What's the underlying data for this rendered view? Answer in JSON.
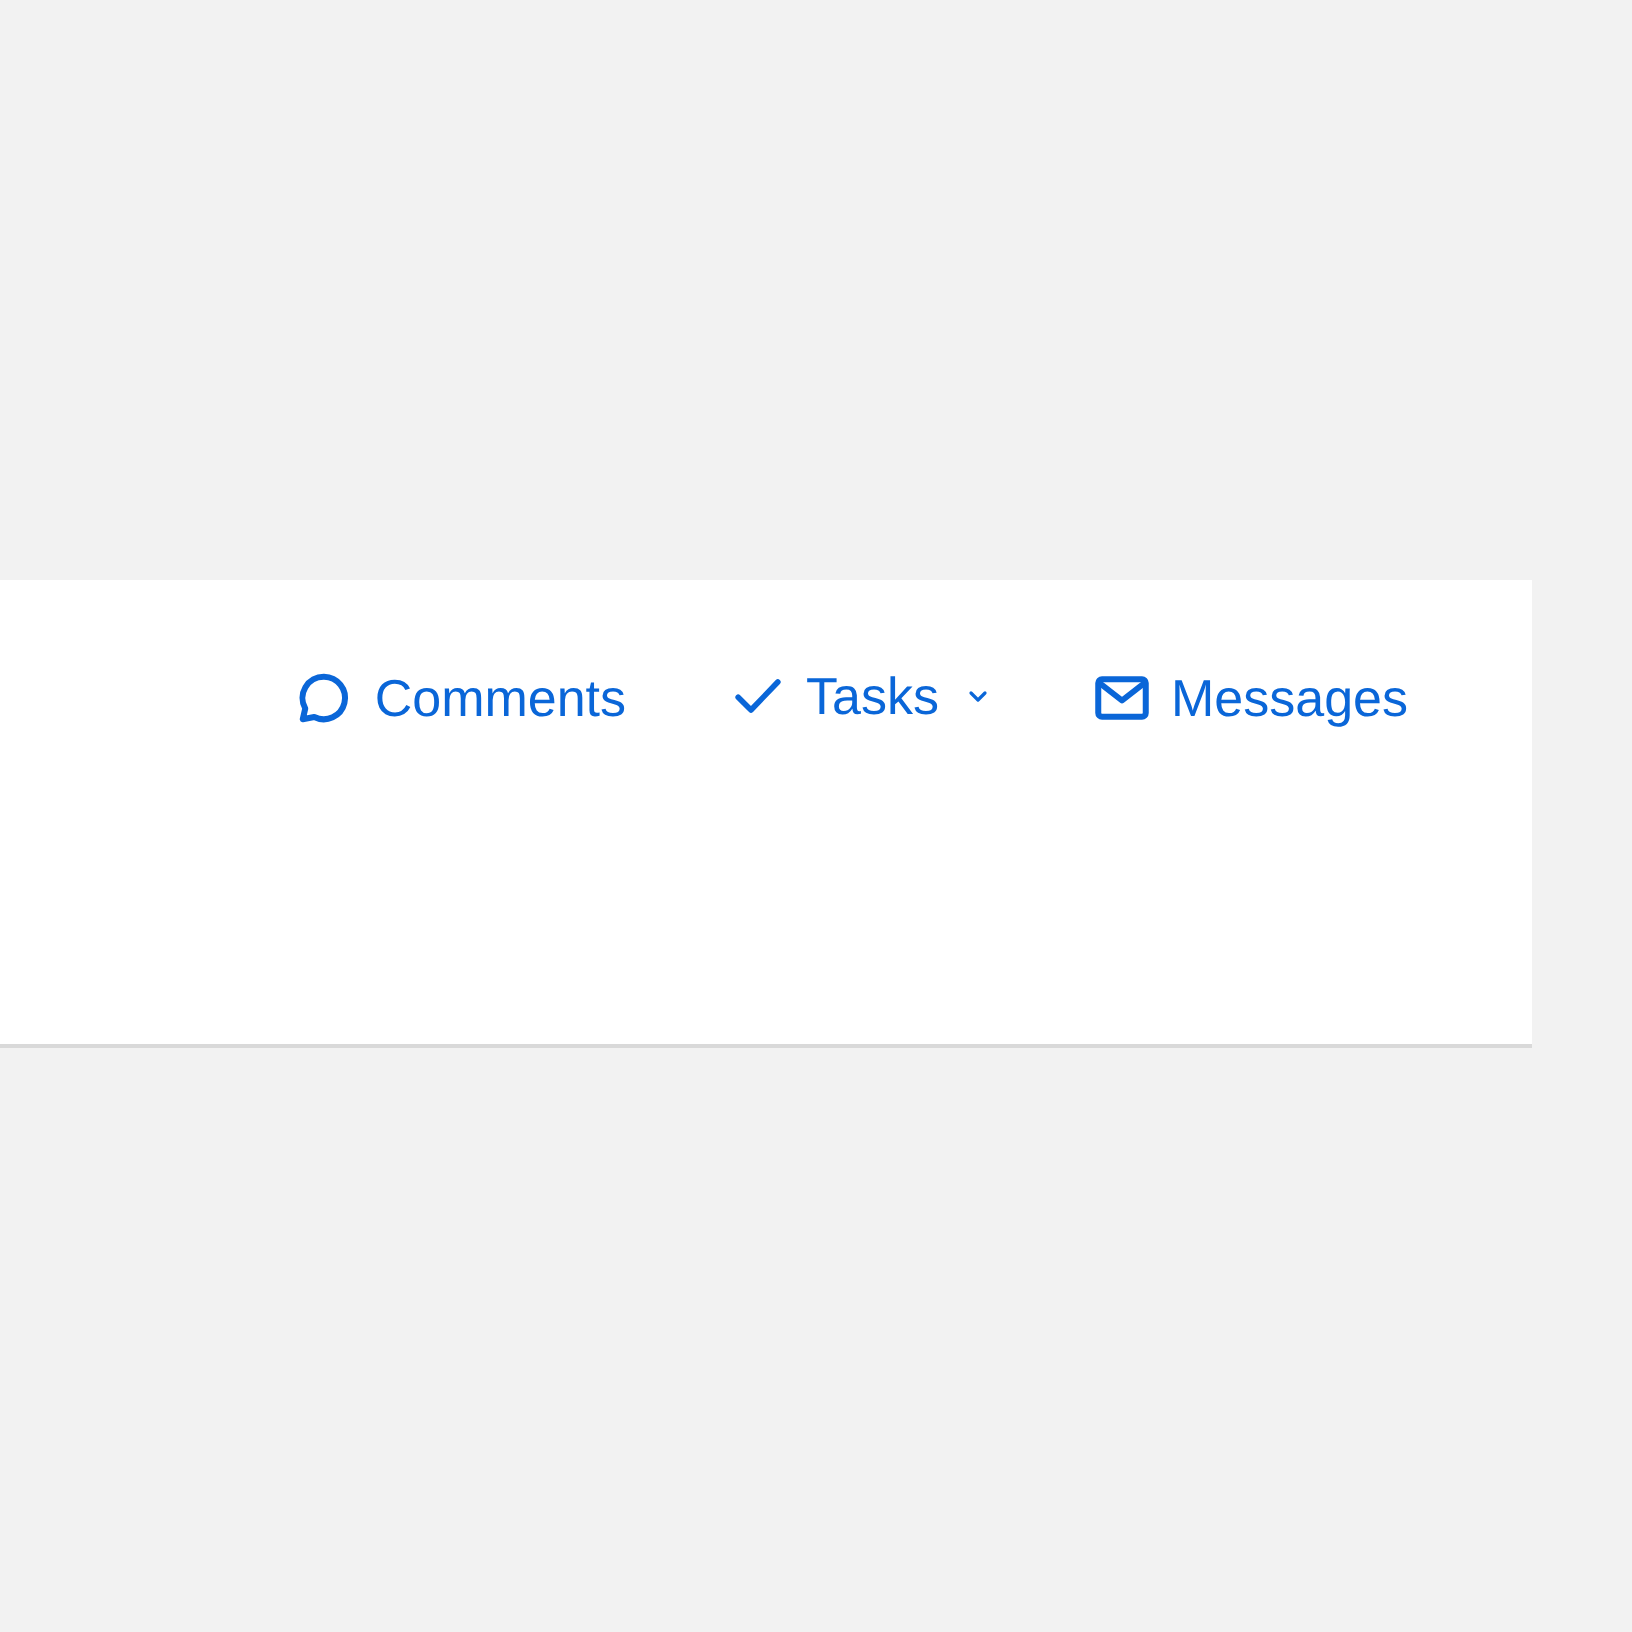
{
  "toolbar": {
    "links": [
      {
        "kind": "comments",
        "label": "Comments",
        "dropdown": false
      },
      {
        "kind": "tasks",
        "label": "Tasks",
        "dropdown": true
      },
      {
        "kind": "messages",
        "label": "Messages",
        "dropdown": false
      }
    ]
  }
}
